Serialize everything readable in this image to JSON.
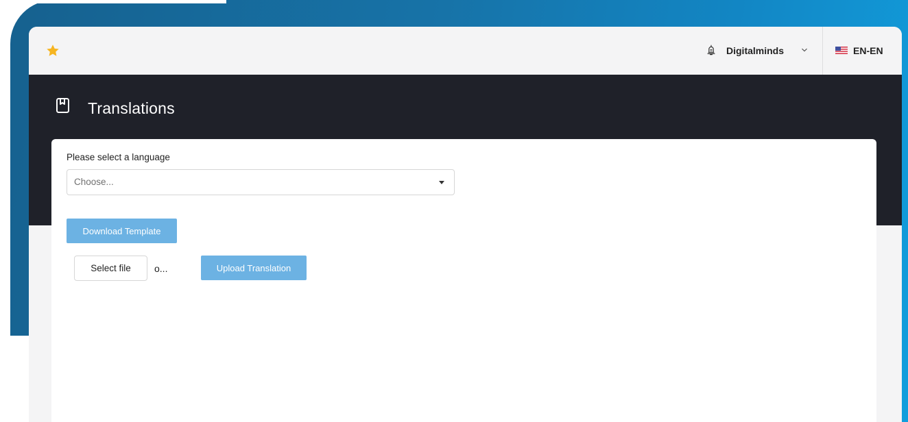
{
  "topbar": {
    "favorite_icon": "star-icon",
    "notification_icon": "bell-icon",
    "organization": "Digitalminds",
    "organization_menu_icon": "chevron-down-icon",
    "language_flag": "us-flag-icon",
    "language": "EN-EN"
  },
  "header": {
    "icon": "book-icon",
    "title": "Translations"
  },
  "form": {
    "language_label": "Please select a language",
    "language_select": {
      "value": "Choose...",
      "options": [
        "Choose..."
      ]
    },
    "download_button": "Download Template",
    "select_file_button": "Select file",
    "file_status": "o...",
    "upload_button": "Upload Translation"
  },
  "colors": {
    "accent": "#6cb2e3",
    "header_bg": "#1f2129",
    "background_gradient_start": "#16618f",
    "background_gradient_end": "#119edd",
    "star": "#f6b521"
  }
}
